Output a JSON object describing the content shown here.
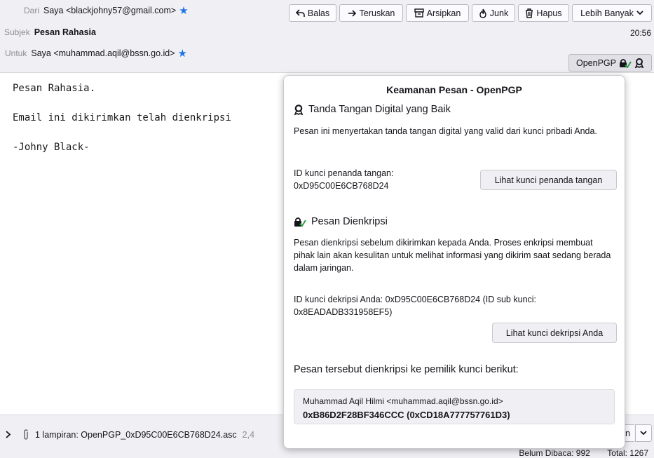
{
  "header": {
    "from_label": "Dari",
    "from_value": "Saya <blackjohny57@gmail.com>",
    "subject_label": "Subjek",
    "subject_value": "Pesan Rahasia",
    "to_label": "Untuk",
    "to_value": "Saya <muhammad.aqil@bssn.go.id>",
    "time": "20:56",
    "star_icon": "star-icon",
    "star_color": "#1a73e8"
  },
  "toolbar": {
    "reply": "Balas",
    "forward": "Teruskan",
    "archive": "Arsipkan",
    "junk": "Junk",
    "delete": "Hapus",
    "more": "Lebih Banyak",
    "openpgp": "OpenPGP"
  },
  "message": {
    "line1": "Pesan Rahasia.",
    "line2": "Email ini dikirimkan telah dienkripsi",
    "line3": "-Johny Black-"
  },
  "attachment": {
    "label": "1 lampiran: OpenPGP_0xD95C00E6CB768D24.asc",
    "size": "2,4",
    "save_partial": "an"
  },
  "status": {
    "unread": "Belum Dibaca: 992",
    "total": "Total: 1267"
  },
  "panel": {
    "title": "Keamanan Pesan - OpenPGP",
    "signature_heading": "Tanda Tangan Digital yang Baik",
    "signature_text": "Pesan ini menyertakan tanda tangan digital yang valid dari kunci pribadi Anda.",
    "signer_label": "ID kunci penanda tangan:",
    "signer_id": "0xD95C00E6CB768D24",
    "view_signer_button": "Lihat kunci penanda tangan",
    "encrypted_heading": "Pesan Dienkripsi",
    "encrypted_text": "Pesan dienkripsi sebelum dikirimkan kepada Anda. Proses enkripsi membuat pihak lain akan kesulitan untuk melihat informasi yang dikirim saat sedang berada dalam jaringan.",
    "decrypt_id_text": "ID kunci dekripsi Anda: 0xD95C00E6CB768D24 (ID sub kunci: 0x8EADADB331958EF5)",
    "view_decrypt_button": "Lihat kunci dekripsi Anda",
    "recipients_heading": "Pesan tersebut dienkripsi ke pemilik kunci berikut:",
    "recipient_name": "Muhammad Aqil Hilmi <muhammad.aqil@bssn.go.id>",
    "recipient_keys": "0xB86D2F28BF346CCC (0xCD18A777757761D3)",
    "check_color": "#2ea043"
  }
}
